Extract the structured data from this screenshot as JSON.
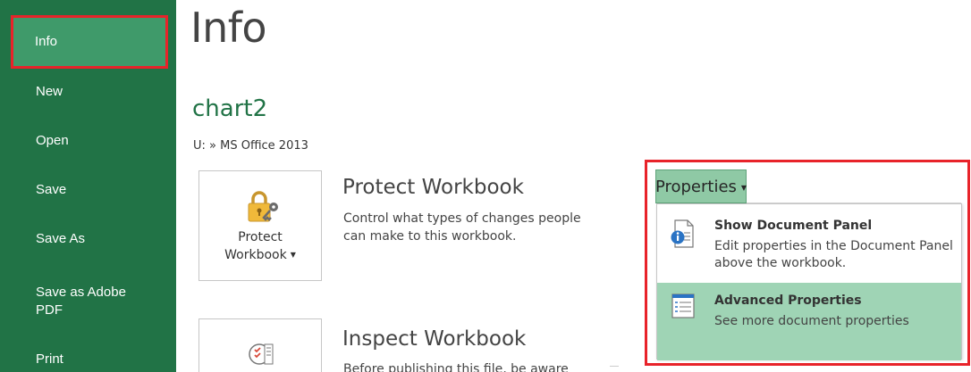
{
  "sidebar": {
    "items": [
      {
        "label": "Info"
      },
      {
        "label": "New"
      },
      {
        "label": "Open"
      },
      {
        "label": "Save"
      },
      {
        "label": "Save As"
      },
      {
        "label": "Save as Adobe PDF"
      },
      {
        "label": "Print"
      }
    ]
  },
  "main": {
    "title": "Info",
    "file_name": "chart2",
    "file_path": "U: » MS Office 2013",
    "protect": {
      "tile_label_line1": "Protect",
      "tile_label_line2": "Workbook",
      "title": "Protect Workbook",
      "description": "Control what types of changes people can make to this workbook."
    },
    "inspect": {
      "title": "Inspect Workbook",
      "description": "Before publishing this file, be aware"
    }
  },
  "properties": {
    "button_label": "Properties",
    "menu": [
      {
        "title": "Show Document Panel",
        "description": "Edit properties in the Document Panel above the workbook.",
        "icon": "document-panel-icon"
      },
      {
        "title": "Advanced Properties",
        "description": "See more document properties",
        "icon": "properties-list-icon"
      }
    ]
  },
  "colors": {
    "sidebar_bg": "#217346",
    "active_item_bg": "#3f9a6a",
    "annotation_red": "#e8232a",
    "accent_green": "#217346",
    "button_bg": "#8fc9a5",
    "menu_highlight": "#9fd4b5"
  }
}
